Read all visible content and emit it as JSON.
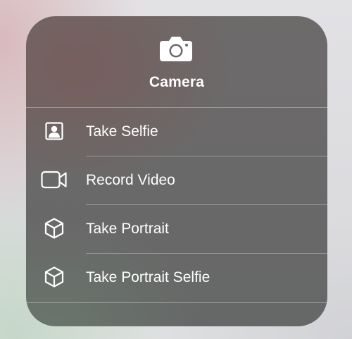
{
  "menu": {
    "header": {
      "title": "Camera",
      "icon": "camera-icon"
    },
    "items": [
      {
        "label": "Take Selfie",
        "icon": "person-portrait-icon"
      },
      {
        "label": "Record Video",
        "icon": "video-camera-icon"
      },
      {
        "label": "Take Portrait",
        "icon": "cube-icon"
      },
      {
        "label": "Take Portrait Selfie",
        "icon": "cube-icon"
      }
    ]
  },
  "colors": {
    "menu_background": "#6a6969",
    "text": "#ffffff",
    "separator": "rgba(255,255,255,0.32)"
  }
}
